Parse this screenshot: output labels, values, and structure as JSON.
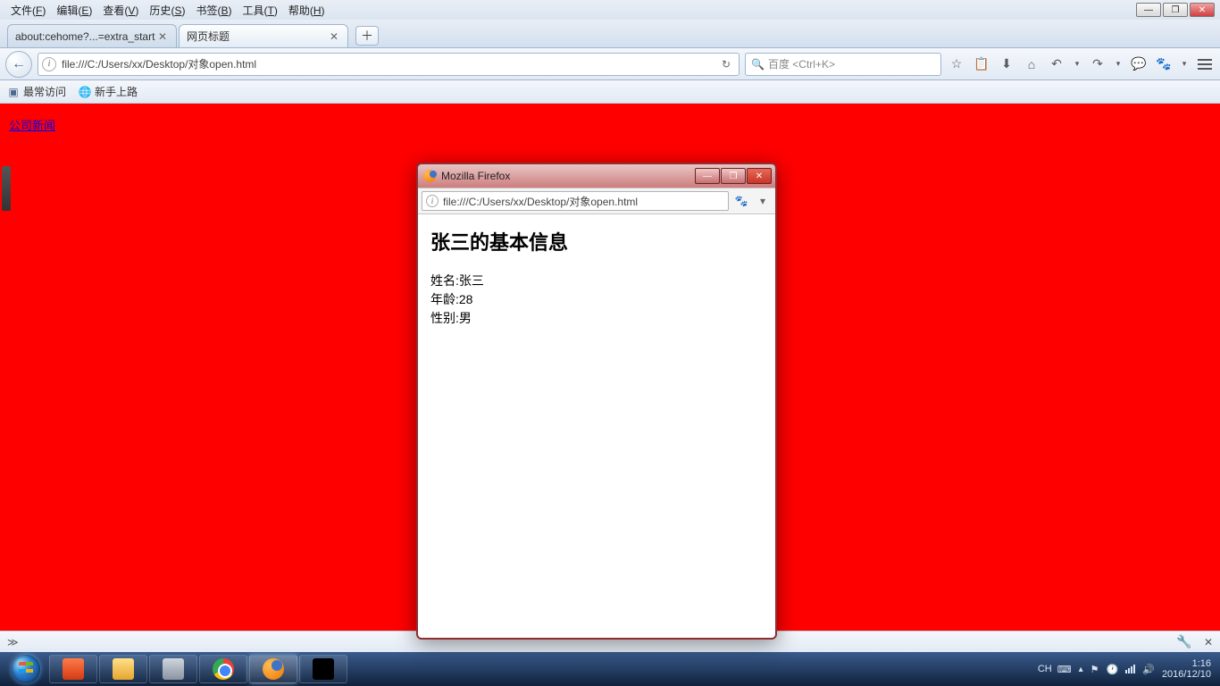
{
  "menubar": {
    "items": [
      {
        "label": "文件",
        "key": "F"
      },
      {
        "label": "编辑",
        "key": "E"
      },
      {
        "label": "查看",
        "key": "V"
      },
      {
        "label": "历史",
        "key": "S"
      },
      {
        "label": "书签",
        "key": "B"
      },
      {
        "label": "工具",
        "key": "T"
      },
      {
        "label": "帮助",
        "key": "H"
      }
    ]
  },
  "tabs": {
    "t0": {
      "label": "about:cehome?...=extra_start"
    },
    "t1": {
      "label": "网页标题"
    }
  },
  "urlbar": {
    "text": "file:///C:/Users/xx/Desktop/对象open.html"
  },
  "searchbar": {
    "placeholder": "百度 <Ctrl+K>"
  },
  "bookmarks": {
    "b0": {
      "label": "最常访问"
    },
    "b1": {
      "label": "新手上路"
    }
  },
  "page": {
    "link_text": "公司新闻"
  },
  "popup": {
    "title": "Mozilla Firefox",
    "url": "file:///C:/Users/xx/Desktop/对象open.html",
    "heading": "张三的基本信息",
    "rows": {
      "r0_label": "姓名:",
      "r0_val": "张三",
      "r1_label": "年龄:",
      "r1_val": "28",
      "r2_label": "性别:",
      "r2_val": "男"
    }
  },
  "statusrow": {
    "left": "≫"
  },
  "tray": {
    "ime": "CH",
    "time": "1:16",
    "date": "2016/12/10"
  },
  "icons": {
    "back": "←",
    "reload": "↻",
    "magnifier": "🔍",
    "star": "☆",
    "clipboard": "📋",
    "download": "⬇",
    "home": "⌂",
    "undo": "↶",
    "redo": "↷",
    "chat": "💬",
    "paw": "🐾",
    "chevdown": "▾",
    "minimize": "—",
    "maximize": "❐",
    "restore": "❐",
    "close": "✕",
    "plus": "＋",
    "globe": "🌐",
    "infoi": "i",
    "triup": "▴",
    "flag": "⚑",
    "clock": "🕐",
    "speaker": "🔊",
    "wrench": "🔧",
    "x": "✕"
  }
}
